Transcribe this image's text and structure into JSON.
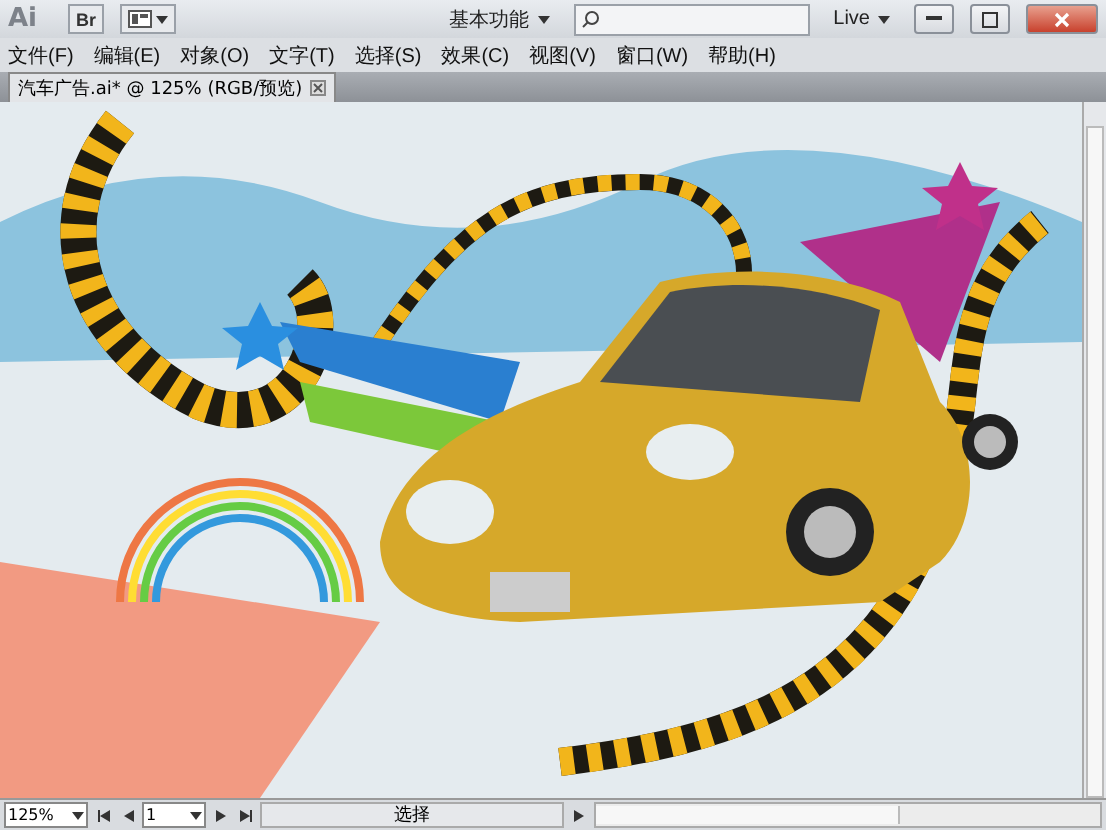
{
  "title_bar": {
    "logo": "Ai",
    "bridge_button": "Br",
    "workspace": "基本功能",
    "live": "Live"
  },
  "menu": [
    {
      "label": "文件(F)"
    },
    {
      "label": "编辑(E)"
    },
    {
      "label": "对象(O)"
    },
    {
      "label": "文字(T)"
    },
    {
      "label": "选择(S)"
    },
    {
      "label": "效果(C)"
    },
    {
      "label": "视图(V)"
    },
    {
      "label": "窗口(W)"
    },
    {
      "label": "帮助(H)"
    }
  ],
  "tabs": [
    {
      "label": "汽车广告.ai* @ 125% (RGB/预览)",
      "selected": true
    }
  ],
  "status_bar": {
    "zoom": "125%",
    "page": "1",
    "tool": "选择"
  }
}
